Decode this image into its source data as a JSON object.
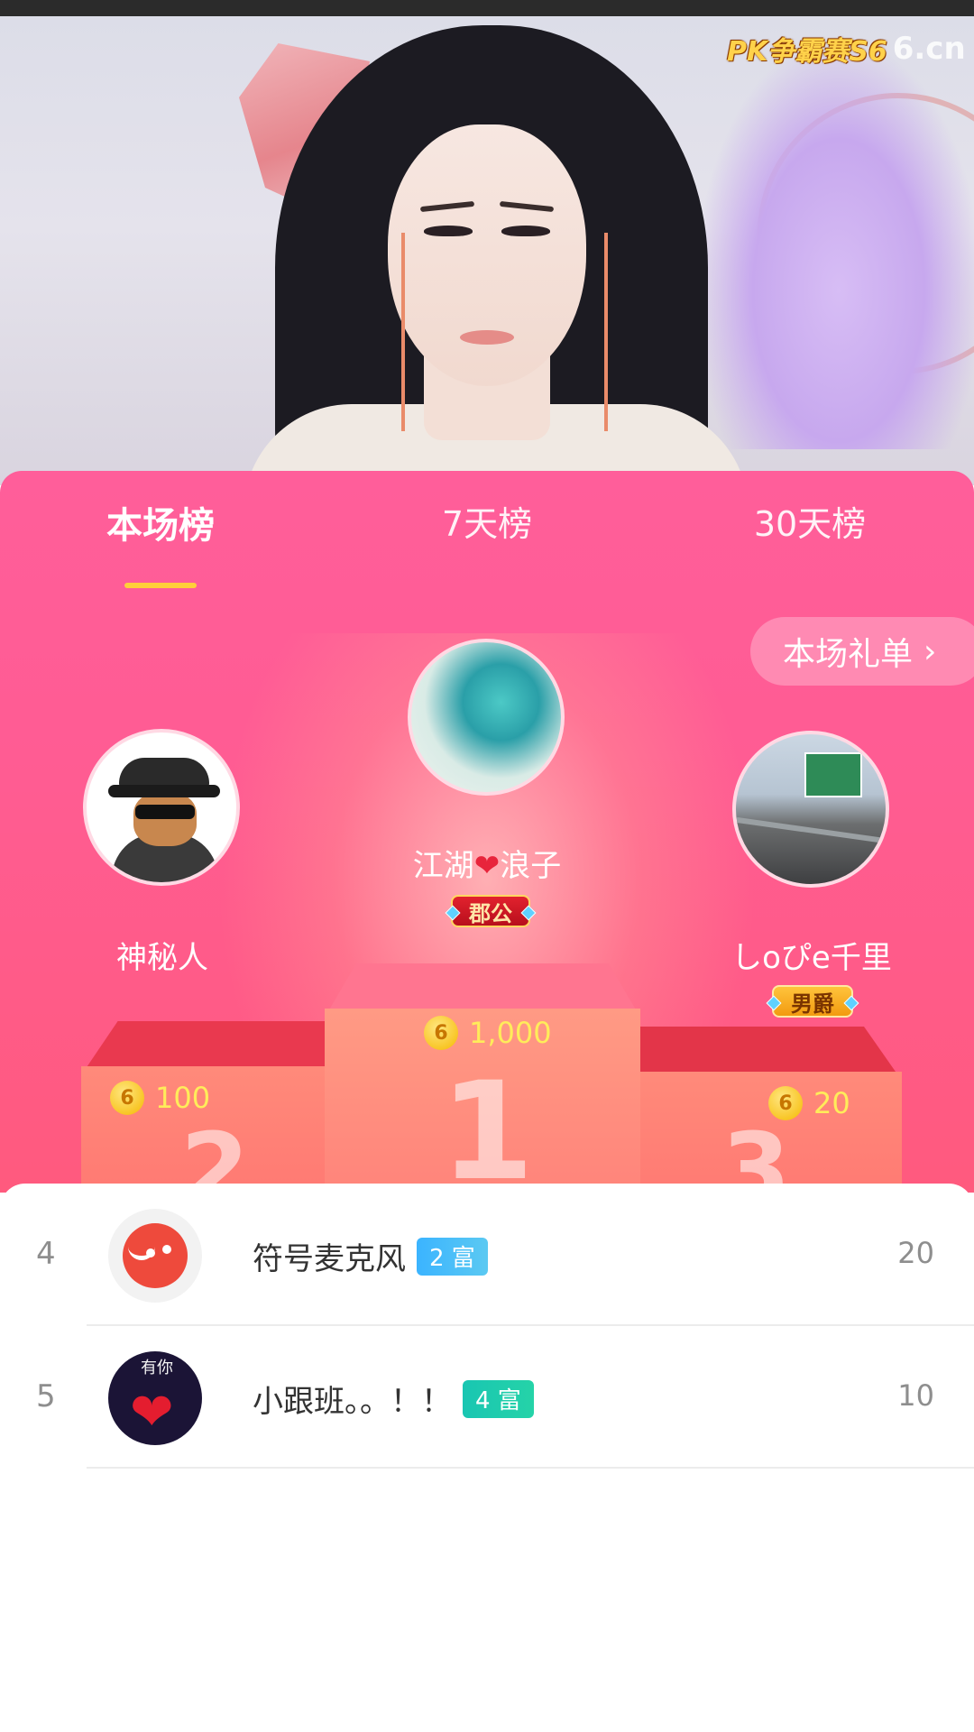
{
  "watermark": {
    "event": "PK争霸赛S6",
    "brand": "6.cn"
  },
  "tabs": [
    {
      "label": "本场榜",
      "active": true
    },
    {
      "label": "7天榜",
      "active": false
    },
    {
      "label": "30天榜",
      "active": false
    }
  ],
  "gift_list": {
    "label": "本场礼单",
    "chevron": "›"
  },
  "podium": {
    "first": {
      "rank": "1",
      "name_part1": "江湖",
      "heart": "❤",
      "name_part2": "浪子",
      "badge": "郡公",
      "score": "1,000",
      "coin_symbol": "6",
      "avatar_icon": "dragon-avatar"
    },
    "second": {
      "rank": "2",
      "name": "神秘人",
      "score": "100",
      "coin_symbol": "6",
      "avatar_icon": "mystery-man-avatar"
    },
    "third": {
      "rank": "3",
      "name": "しoぴe千里",
      "badge": "男爵",
      "score": "20",
      "coin_symbol": "6",
      "avatar_icon": "highway-photo-avatar"
    }
  },
  "list": [
    {
      "rank": "4",
      "name": "符号麦克风",
      "level": "2 富",
      "value": "20",
      "level_color": "#3bb4ff",
      "avatar_icon": "microphone-face-avatar"
    },
    {
      "rank": "5",
      "name": "小跟班。。！！",
      "level": "4 富",
      "value": "10",
      "level_color": "#19c6b2",
      "avatar_icon": "heart-avatar"
    }
  ],
  "heart_avatar_text": "有你"
}
